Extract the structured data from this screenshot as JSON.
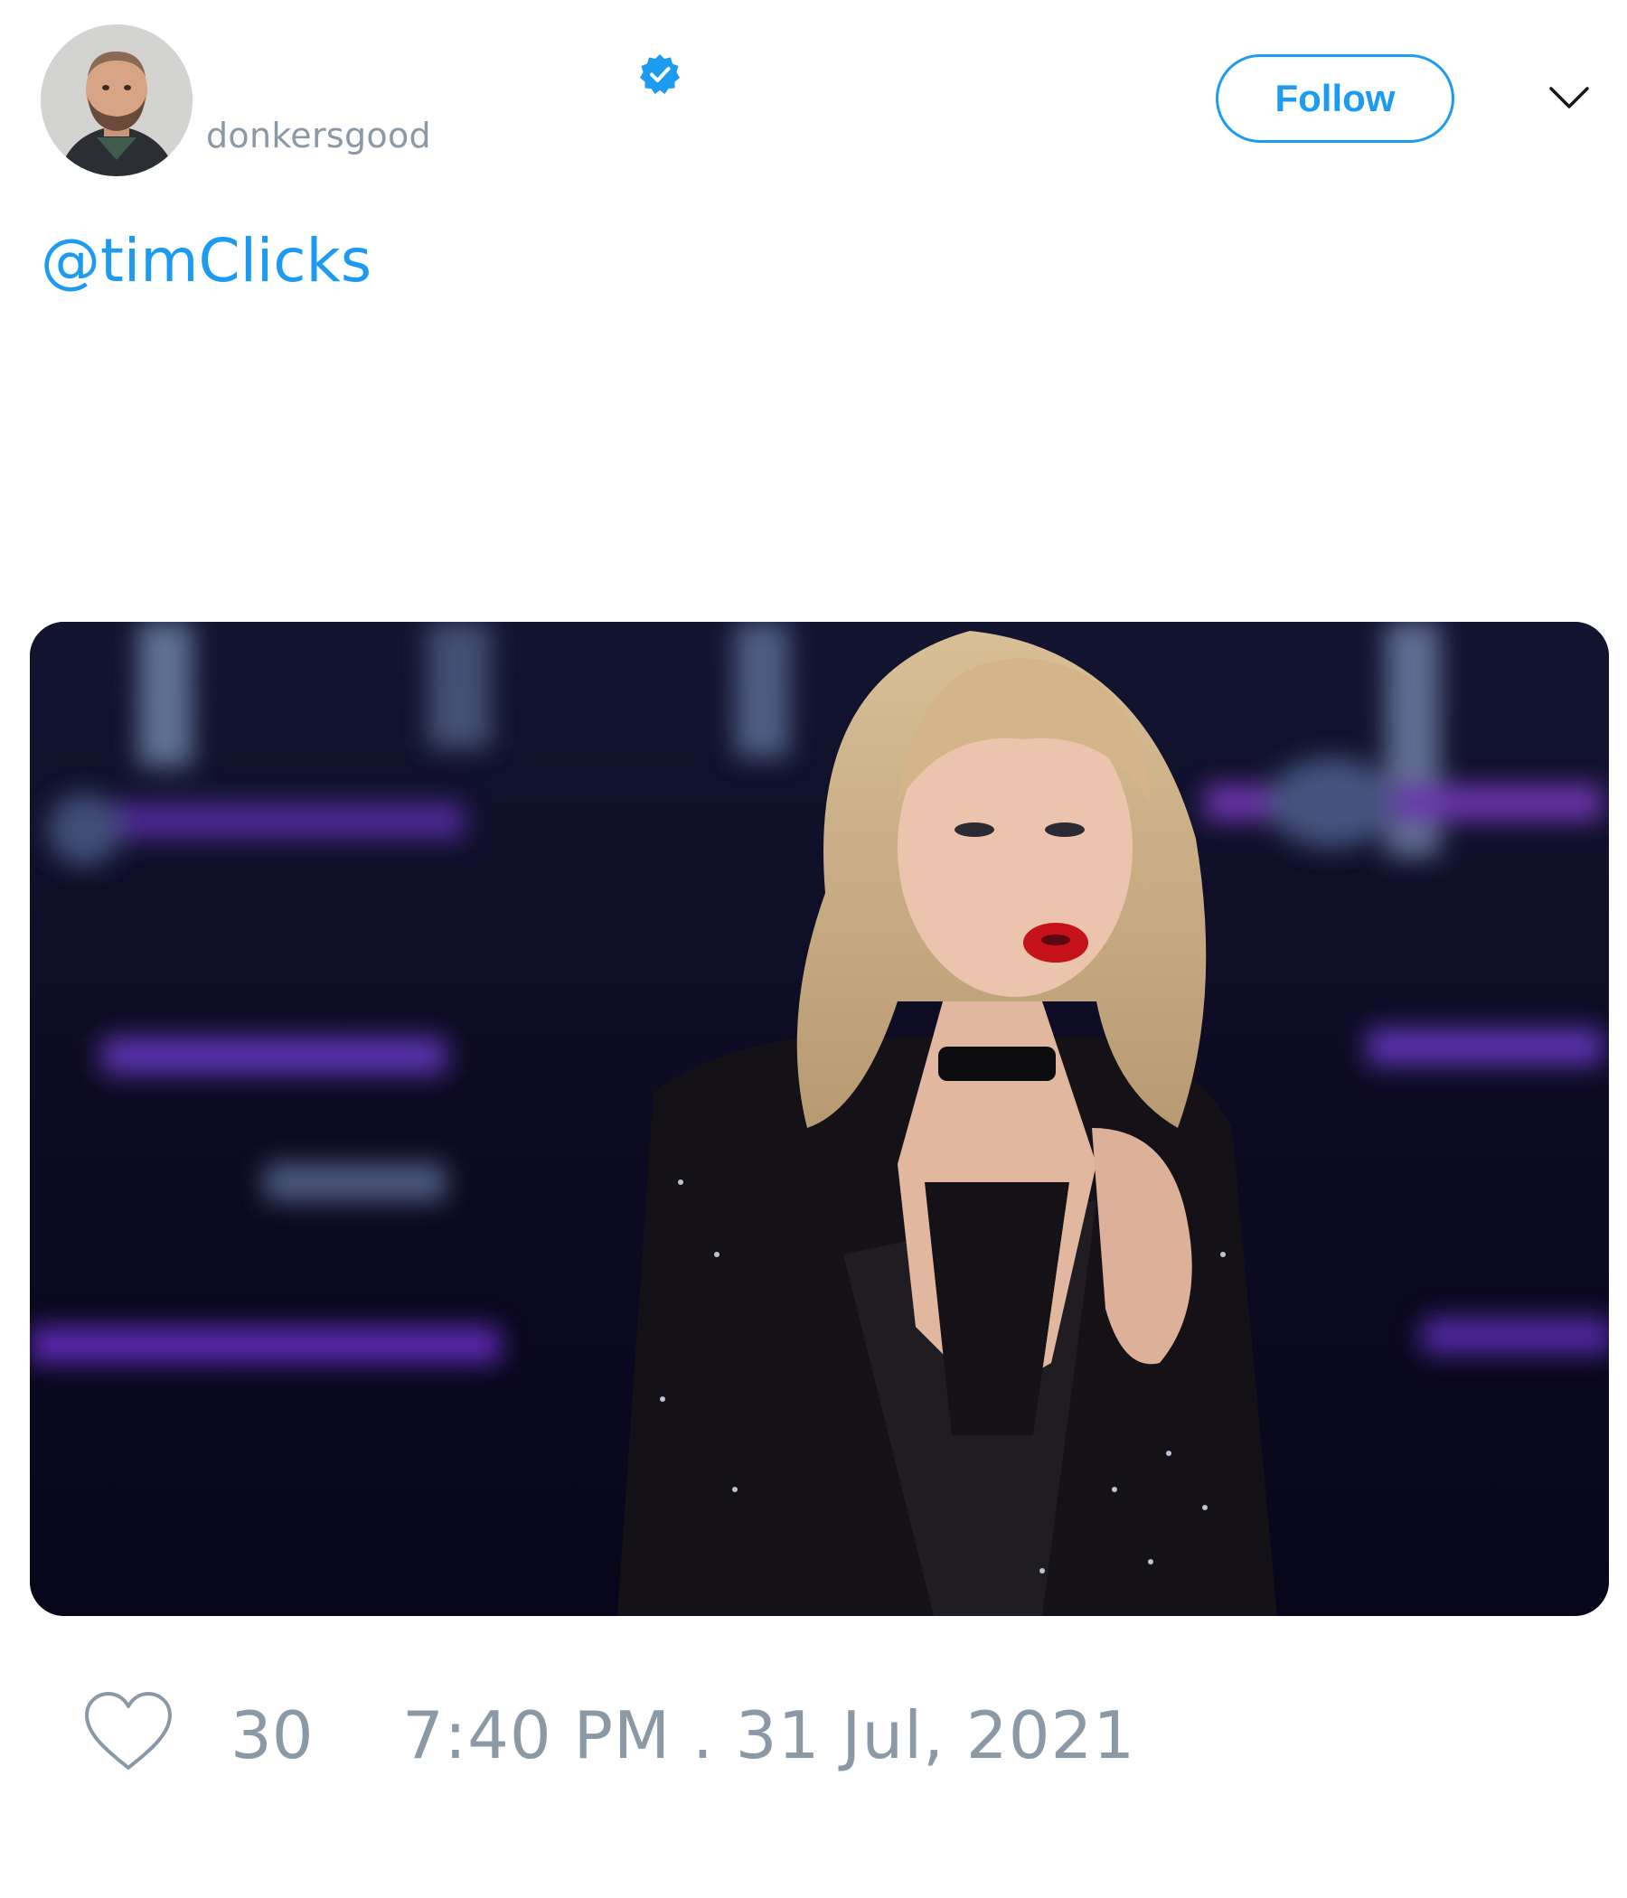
{
  "header": {
    "display_name": "",
    "username": "donkersgood",
    "verified": true,
    "follow_label": "Follow",
    "menu_icon": "chevron-down-icon",
    "avatar_icon": "user-avatar"
  },
  "tweet": {
    "text": "@timClicks",
    "media_icon": "gif-image"
  },
  "footer": {
    "like_icon": "heart-outline-icon",
    "like_count": "30",
    "timestamp": "7:40 PM . 31 Jul, 2021"
  },
  "colors": {
    "accent": "#1d9bf0",
    "muted": "#8b98a5",
    "background": "#ffffff"
  }
}
